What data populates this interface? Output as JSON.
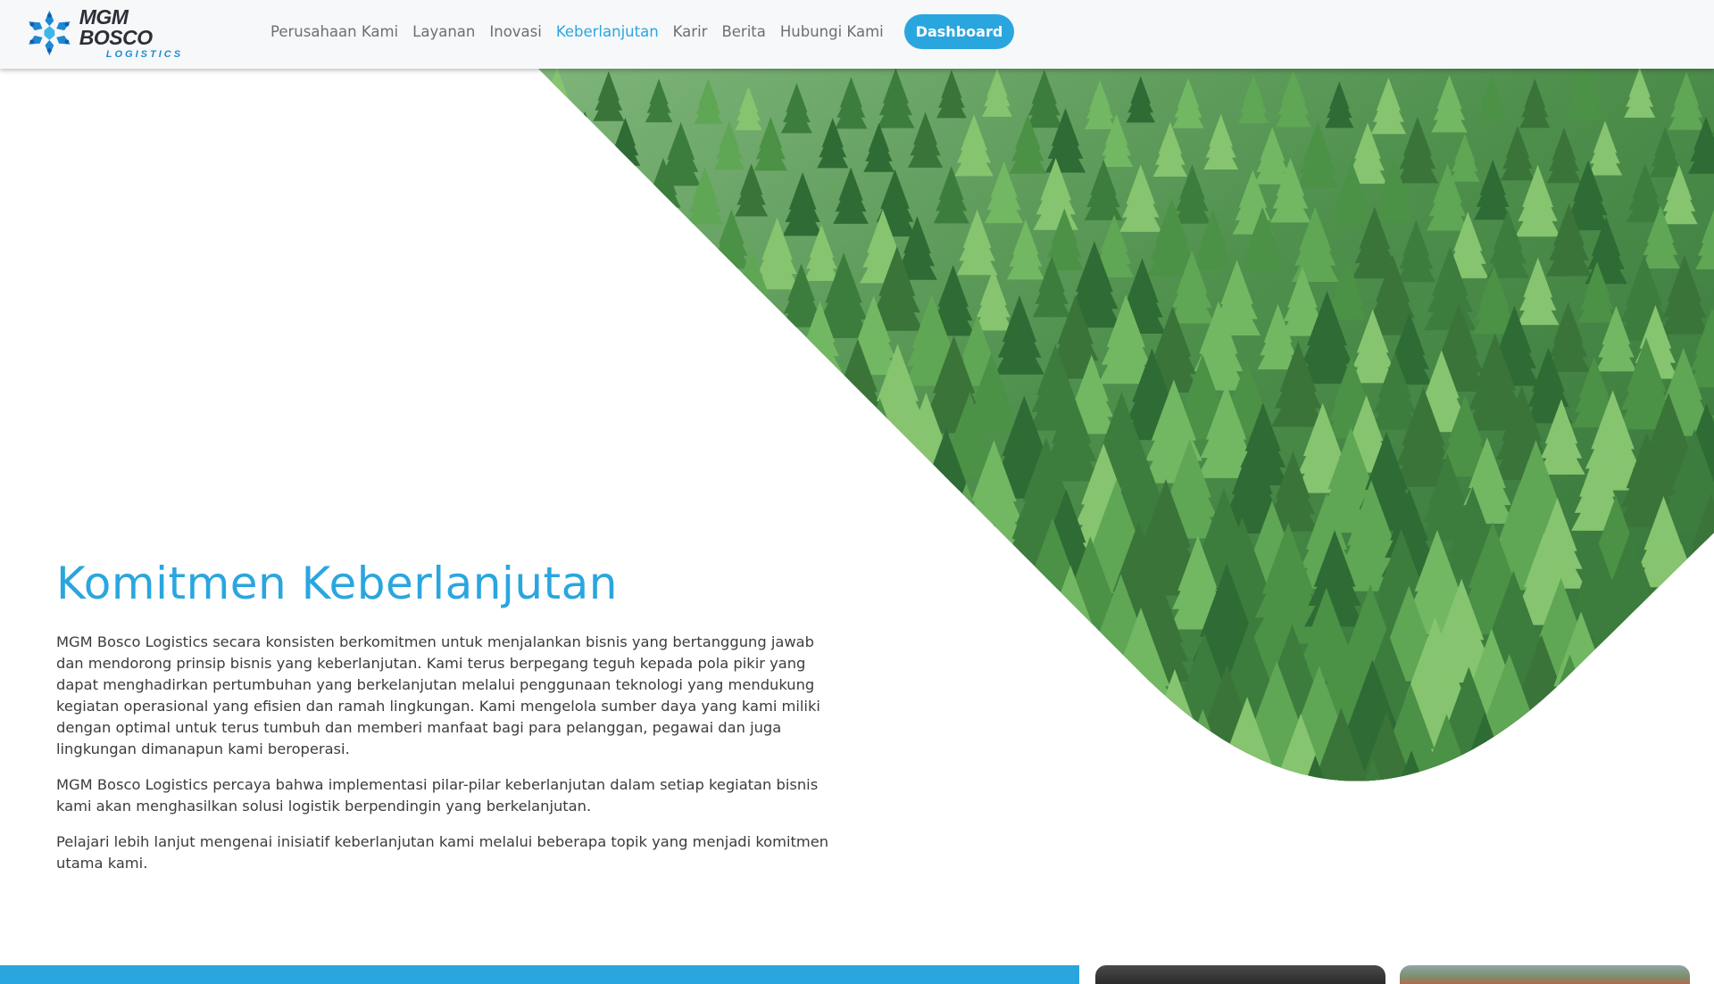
{
  "brand": {
    "name": "MGM BOSCO",
    "tagline": "LOGISTICS",
    "primary_color": "#2aa6df"
  },
  "nav": {
    "items": [
      {
        "label": "Perusahaan Kami",
        "active": false
      },
      {
        "label": "Layanan",
        "active": false
      },
      {
        "label": "Inovasi",
        "active": false
      },
      {
        "label": "Keberlanjutan",
        "active": true
      },
      {
        "label": "Karir",
        "active": false
      },
      {
        "label": "Berita",
        "active": false
      },
      {
        "label": "Hubungi Kami",
        "active": false
      }
    ],
    "dashboard_label": "Dashboard"
  },
  "hero": {
    "image": "forest-icon",
    "title": "Komitmen Keberlanjutan",
    "paragraphs": [
      "MGM Bosco Logistics secara konsisten berkomitmen untuk menjalankan bisnis yang bertanggung jawab dan mendorong prinsip bisnis yang keberlanjutan. Kami terus berpegang teguh kepada pola pikir yang dapat menghadirkan pertumbuhan yang berkelanjutan melalui penggunaan teknologi yang mendukung kegiatan operasional yang efisien dan ramah lingkungan. Kami mengelola sumber daya yang kami miliki dengan optimal untuk terus tumbuh dan memberi manfaat bagi para pelanggan, pegawai dan juga lingkungan dimanapun kami beroperasi.",
      "MGM Bosco Logistics percaya bahwa implementasi pilar-pilar keberlanjutan dalam setiap kegiatan bisnis kami akan menghasilkan solusi logistik berpendingin yang berkelanjutan.",
      "Pelajari lebih lanjut mengenai inisiatif keberlanjutan kami melalui beberapa topik yang menjadi komitmen utama kami."
    ]
  }
}
